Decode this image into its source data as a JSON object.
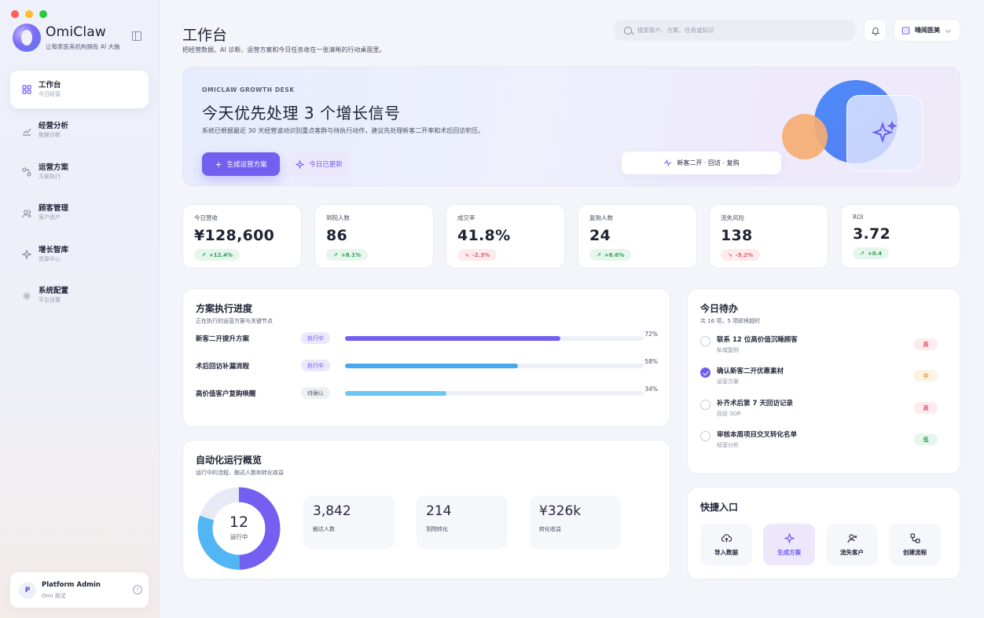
{
  "colors": {
    "accent": "#7360f0",
    "positive": "#2f9e5a",
    "negative": "#e2576a"
  },
  "sidebar": {
    "brand": "OmiClaw",
    "tagline": "让每家医美机构拥有 AI 大脑",
    "items": [
      {
        "label": "工作台",
        "sub": "今日经营",
        "icon": "dashboard-icon"
      },
      {
        "label": "经营分析",
        "sub": "数据诊断",
        "icon": "chart-icon"
      },
      {
        "label": "运营方案",
        "sub": "方案执行",
        "icon": "flow-icon"
      },
      {
        "label": "顾客管理",
        "sub": "客户资产",
        "icon": "users-icon"
      },
      {
        "label": "增长智库",
        "sub": "资源中心",
        "icon": "sparkle-icon"
      },
      {
        "label": "系统配置",
        "sub": "平台设置",
        "icon": "gear-icon"
      }
    ],
    "user": {
      "initial": "P",
      "name": "Platform Admin",
      "org": "Omi 测试"
    }
  },
  "header": {
    "title": "工作台",
    "desc": "把经营数据、AI 诊断、运营方案和今日任务收在一张清晰的行动桌面里。",
    "search_placeholder": "搜索客户、方案、任务或知识",
    "org": "晴阅医美"
  },
  "hero": {
    "eyebrow": "OMICLAW GROWTH DESK",
    "title": "今天优先处理 3 个增长信号",
    "desc": "系统已根据最近 30 天经营波动识别重点客群与待执行动作，建议先处理新客二开率和术后回访积压。",
    "primary_btn": "生成运营方案",
    "ghost_btn": "今日已更新",
    "pill": "新客二开 · 回访 · 复购"
  },
  "stats": [
    {
      "label": "今日营收",
      "value": "¥128,600",
      "delta": "+12.4%",
      "dir": "up"
    },
    {
      "label": "到院人数",
      "value": "86",
      "delta": "+8.1%",
      "dir": "up"
    },
    {
      "label": "成交率",
      "value": "41.8%",
      "delta": "-2.3%",
      "dir": "down"
    },
    {
      "label": "复购人数",
      "value": "24",
      "delta": "+6.6%",
      "dir": "up"
    },
    {
      "label": "流失风险",
      "value": "138",
      "delta": "-5.2%",
      "dir": "down"
    },
    {
      "label": "ROI",
      "value": "3.72",
      "delta": "+0.4",
      "dir": "up"
    }
  ],
  "progress": {
    "title": "方案执行进度",
    "sub": "正在执行的运营方案与关键节点",
    "rows": [
      {
        "name": "新客二开提升方案",
        "status": "执行中",
        "pct": 72,
        "pct_label": "72%",
        "color": "#7360f0",
        "state": "run"
      },
      {
        "name": "术后回访补漏流程",
        "status": "执行中",
        "pct": 58,
        "pct_label": "58%",
        "color": "#4aa8f0",
        "state": "run"
      },
      {
        "name": "高价值客户复购唤醒",
        "status": "待确认",
        "pct": 34,
        "pct_label": "34%",
        "color": "#6cc7f2",
        "state": "wait"
      }
    ]
  },
  "todo": {
    "title": "今日待办",
    "sub": "共 16 项，5 项即将超时",
    "items": [
      {
        "title": "联系 12 位高价值沉睡顾客",
        "sub": "私域复购",
        "prio": "高",
        "level": "high",
        "done": false
      },
      {
        "title": "确认新客二开优惠素材",
        "sub": "运营方案",
        "prio": "中",
        "level": "mid",
        "done": true
      },
      {
        "title": "补齐术后第 7 天回访记录",
        "sub": "回访 SOP",
        "prio": "高",
        "level": "high",
        "done": false
      },
      {
        "title": "审核本周项目交叉转化名单",
        "sub": "经营分析",
        "prio": "低",
        "level": "low",
        "done": false
      }
    ]
  },
  "automation": {
    "title": "自动化运行概览",
    "sub": "运行中的流程、触达人数和转化收益",
    "running_count": "12",
    "running_label": "运行中",
    "donut_share": 0.8,
    "stats": [
      {
        "value": "3,842",
        "label": "触达人数"
      },
      {
        "value": "214",
        "label": "到院转化"
      },
      {
        "value": "¥326k",
        "label": "转化收益"
      }
    ]
  },
  "quick": {
    "title": "快捷入口",
    "items": [
      {
        "label": "导入数据",
        "icon": "upload-icon"
      },
      {
        "label": "生成方案",
        "icon": "sparkle-icon"
      },
      {
        "label": "流失客户",
        "icon": "user-x-icon"
      },
      {
        "label": "创建流程",
        "icon": "flow-icon"
      }
    ]
  }
}
